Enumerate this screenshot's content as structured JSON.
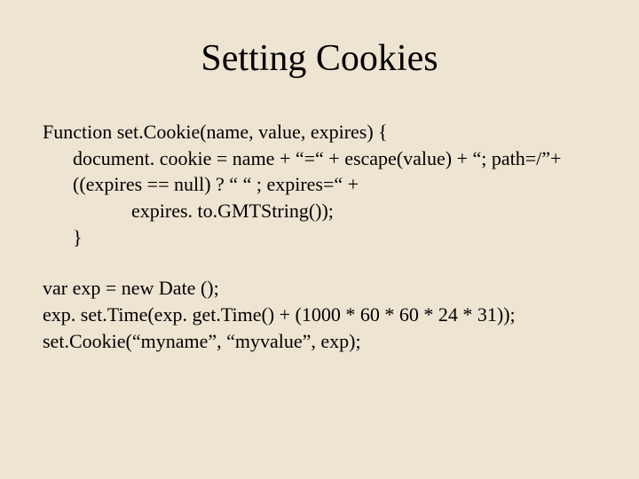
{
  "title": "Setting Cookies",
  "code": {
    "fn_decl": "Function set.Cookie(name, value, expires) {",
    "line1": "document. cookie = name + “=“ + escape(value) + “; path=/”+",
    "line2": "((expires == null) ? “ “ ; expires=“ +",
    "line3": "expires. to.GMTString());",
    "close": "}"
  },
  "usage": {
    "u1": "var exp = new Date ();",
    "u2": "exp. set.Time(exp. get.Time() + (1000 * 60 * 60 * 24 * 31));",
    "u3": "set.Cookie(“myname”, “myvalue”, exp);"
  }
}
